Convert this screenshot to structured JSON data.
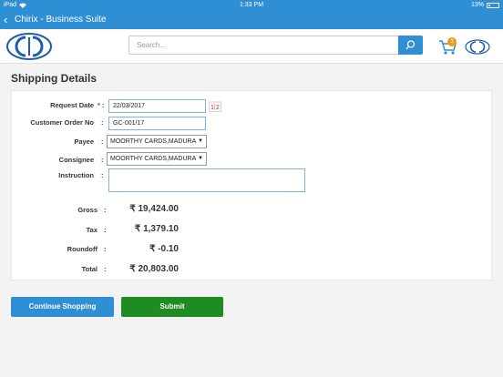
{
  "status_bar": {
    "device": "iPad",
    "time": "1:33 PM",
    "battery": "13%"
  },
  "title_bar": {
    "back_icon": "chevron-left-icon",
    "title": "Chirix - Business Suite"
  },
  "header": {
    "search": {
      "placeholder": "Search...",
      "value": ""
    },
    "cart_count": "3",
    "icons": [
      "logo-icon",
      "search-icon",
      "cart-icon",
      "logo-small-icon"
    ]
  },
  "page": {
    "title": "Shipping Details",
    "form": {
      "request_date": {
        "label": "Request Date",
        "required_mark": "*",
        "value": "22/03/2017",
        "calendar_icon": "calendar-icon"
      },
      "customer_order": {
        "label": "Customer Order No",
        "value": "GC-001/17"
      },
      "payee": {
        "label": "Payee",
        "value": "MOORTHY CARDS,MADURA"
      },
      "consignee": {
        "label": "Consignee",
        "value": "MOORTHY CARDS,MADURA"
      },
      "instruction": {
        "label": "Instruction",
        "value": ""
      }
    },
    "summary": {
      "gross": {
        "label": "Gross",
        "value": "₹ 19,424.00"
      },
      "tax": {
        "label": "Tax",
        "value": "₹ 1,379.10"
      },
      "roundoff": {
        "label": "Roundoff",
        "value": "₹ -0.10"
      },
      "total": {
        "label": "Total",
        "value": "₹ 20,803.00"
      }
    },
    "buttons": {
      "continue": "Continue Shopping",
      "submit": "Submit"
    }
  },
  "colors": {
    "brand_blue": "#2f8fd4",
    "submit_green": "#1e8c22",
    "badge_orange": "#f09a1a",
    "required_red": "#d9261c"
  }
}
